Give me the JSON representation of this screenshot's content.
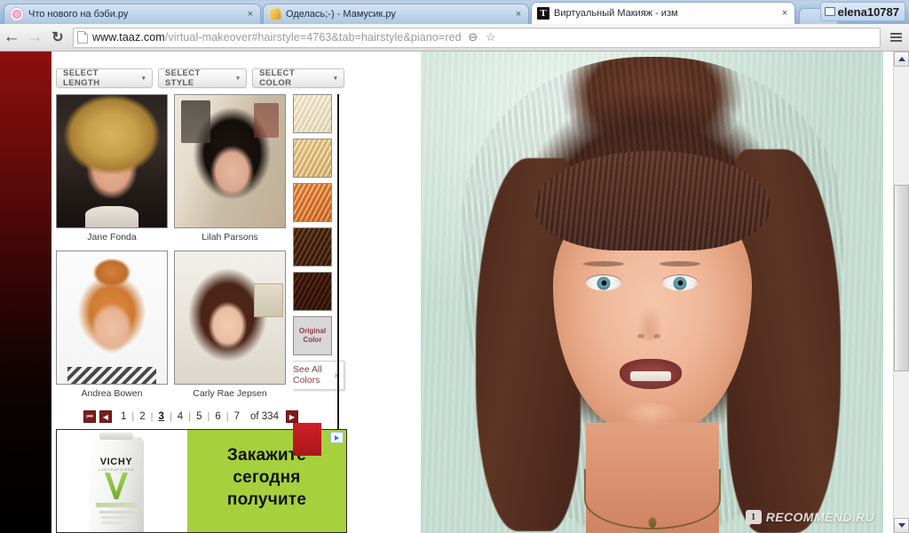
{
  "browser": {
    "tabs": [
      {
        "title": "Что нового на бэби.ру",
        "favicon": "baby-icon",
        "active": false,
        "close_label": "×"
      },
      {
        "title": "Оделась;-) - Мамусик.ру",
        "favicon": "mamusik-icon",
        "active": false,
        "close_label": "×"
      },
      {
        "title": "Виртуальный Макияж - изм",
        "favicon": "taaz-icon",
        "favicon_letter": "T",
        "active": true,
        "close_label": "×"
      }
    ],
    "user_badge": "elena10787",
    "nav": {
      "back": "←",
      "forward": "→",
      "reload": "↻",
      "zoom_icon": "⊖",
      "bookmark_icon": "☆"
    },
    "url": {
      "host": "www.taaz.com",
      "path": "/virtual-makeover#hairstyle=4763&tab=hairstyle&piano=red",
      "full": "www.taaz.com/virtual-makeover#hairstyle=4763&tab=hairstyle&piano=red"
    }
  },
  "page": {
    "filters": [
      {
        "label": "SELECT LENGTH",
        "caret": "▾"
      },
      {
        "label": "SELECT STYLE",
        "caret": "▾"
      },
      {
        "label": "SELECT COLOR",
        "caret": "▾"
      }
    ],
    "hairstyles": [
      {
        "name": "Jane Fonda",
        "art": "a-jane"
      },
      {
        "name": "Lilah Parsons",
        "art": "a-lilah"
      },
      {
        "name": "Andrea Bowen",
        "art": "a-andrea"
      },
      {
        "name": "Carly Rae Jepsen",
        "art": "a-carly"
      }
    ],
    "colors": {
      "swatches": [
        {
          "name": "light-blonde",
          "hex": "#eadfbf"
        },
        {
          "name": "golden-blonde",
          "hex": "#dcbd82"
        },
        {
          "name": "copper-ginger",
          "hex": "#d9752b"
        },
        {
          "name": "dark-brown",
          "hex": "#32190c"
        },
        {
          "name": "deep-brown",
          "hex": "#2a1208"
        }
      ],
      "original_line1": "Original",
      "original_line2": "Color",
      "see_all_line1": "See All",
      "see_all_line2": "Colors",
      "see_all_chevron": "»"
    },
    "pagination": {
      "first_label": "⏮",
      "prev_label": "◀",
      "next_label": "▶",
      "pages": [
        "1",
        "2",
        "3",
        "4",
        "5",
        "6",
        "7"
      ],
      "current": "3",
      "separator": "|",
      "of_text": "of 334",
      "total_pages": 334
    },
    "ad": {
      "brand": "VICHY",
      "brand_sub": "LABORATOIRES",
      "line1": "Закажите",
      "line2": "сегодня",
      "line3": "получите",
      "adchoices_icon": "adchoices-icon"
    },
    "watermark": {
      "icon_letter": "I",
      "text": "RECOMMEND.RU"
    }
  }
}
